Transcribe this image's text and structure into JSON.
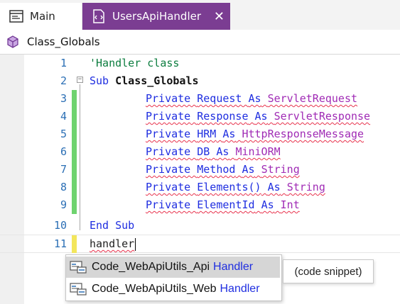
{
  "tabs": [
    {
      "label": "Main",
      "icon": "form-icon",
      "active": false
    },
    {
      "label": "UsersApiHandler",
      "icon": "module-icon",
      "active": true,
      "close": "✕"
    }
  ],
  "colors": {
    "accent": "#7b3d92",
    "keyword": "#1f2ee0",
    "type": "#a02bb5",
    "comment": "#0c7d3f",
    "line_number": "#2b6fb5",
    "changed_bar": "#6fd36f",
    "current_bar": "#f3e65c",
    "squiggle": "#e8334d"
  },
  "header": {
    "title": "Class_Globals",
    "icon": "class-icon"
  },
  "editor": {
    "lines": [
      {
        "num": "1",
        "comment": "'Handler class"
      },
      {
        "num": "2",
        "kw": "Sub",
        "name": "Class_Globals",
        "fold": "−"
      },
      {
        "num": "3",
        "priv": "Private",
        "var": "Request",
        "as": "As",
        "type": "ServletRequest"
      },
      {
        "num": "4",
        "priv": "Private",
        "var": "Response",
        "as": "As",
        "type": "ServletResponse"
      },
      {
        "num": "5",
        "priv": "Private",
        "var": "HRM",
        "as": "As",
        "type": "HttpResponseMessage"
      },
      {
        "num": "6",
        "priv": "Private",
        "var": "DB",
        "as": "As",
        "type": "MiniORM"
      },
      {
        "num": "7",
        "priv": "Private",
        "var": "Method",
        "as": "As",
        "type": "String"
      },
      {
        "num": "8",
        "priv": "Private",
        "var": "Elements()",
        "as": "As",
        "type": "String"
      },
      {
        "num": "9",
        "priv": "Private",
        "var": "ElementId",
        "as": "As",
        "type": "Int"
      },
      {
        "num": "10",
        "text": "End Sub"
      },
      {
        "num": "11",
        "text": "handler"
      }
    ]
  },
  "autocomplete": {
    "items": [
      {
        "name": "Code_WebApiUtils_Api",
        "suffix": "Handler",
        "icon": "code-snippet-icon",
        "selected": true
      },
      {
        "name": "Code_WebApiUtils_Web",
        "suffix": "Handler",
        "icon": "code-snippet-icon",
        "selected": false
      }
    ],
    "tooltip": "(code snippet)"
  }
}
